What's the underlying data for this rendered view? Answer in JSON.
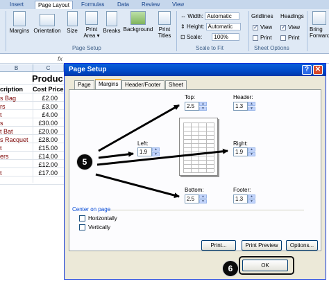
{
  "ribbon": {
    "tabs": [
      {
        "label": "Insert"
      },
      {
        "label": "Page Layout"
      },
      {
        "label": "Formulas"
      },
      {
        "label": "Data"
      },
      {
        "label": "Review"
      },
      {
        "label": "View"
      }
    ],
    "buttons": {
      "margins": "Margins",
      "orientation": "Orientation",
      "size": "Size",
      "print_area_1": "Print",
      "print_area_2": "Area ▾",
      "breaks": "Breaks",
      "background": "Background",
      "print_titles_1": "Print",
      "print_titles_2": "Titles",
      "bring_forward_1": "Bring",
      "bring_forward_2": "Forward"
    },
    "scale": {
      "width_label": "Width:",
      "width_value": "Automatic",
      "height_label": "Height:",
      "height_value": "Automatic",
      "scale_label": "Scale:",
      "scale_value": "100%"
    },
    "sheet_options": {
      "gridlines": "Gridlines",
      "headings": "Headings",
      "view": "View",
      "print": "Print"
    },
    "groups": {
      "page_setup": "Page Setup",
      "scale_to_fit": "Scale to Fit",
      "sheet_options": "Sheet Options"
    }
  },
  "sheet": {
    "formula_icon": "fx",
    "col_b": "B",
    "col_c": "C",
    "title": "Produc",
    "header_b": "cription",
    "header_c": "Cost Price",
    "rows": [
      {
        "b": "s Bag",
        "c": "£2.00"
      },
      {
        "b": "rs",
        "c": "£3.00"
      },
      {
        "b": "t",
        "c": "£4.00"
      },
      {
        "b": "s",
        "c": "£30.00"
      },
      {
        "b": "t Bat",
        "c": "£20.00"
      },
      {
        "b": "s Racquet",
        "c": "£28.00"
      },
      {
        "b": "t",
        "c": "£15.00"
      },
      {
        "b": "ers",
        "c": "£14.00"
      },
      {
        "b": "",
        "c": "£12.00"
      },
      {
        "b": "t",
        "c": "£17.00"
      }
    ]
  },
  "dialog": {
    "title": "Page Setup",
    "help": "?",
    "close": "✕",
    "tabs": [
      {
        "label": "Page"
      },
      {
        "label": "Margins"
      },
      {
        "label": "Header/Footer"
      },
      {
        "label": "Sheet"
      }
    ],
    "margins": {
      "top_label": "Top:",
      "top_value": "2.5",
      "header_label": "Header:",
      "header_value": "1.3",
      "left_label": "Left:",
      "left_value": "1.9",
      "right_label": "Right:",
      "right_value": "1.9",
      "bottom_label": "Bottom:",
      "bottom_value": "2.5",
      "footer_label": "Footer:",
      "footer_value": "1.3"
    },
    "center_on_page": {
      "legend": "Center on page",
      "horizontally": "Horizontally",
      "vertically": "Vertically",
      "horizontally_checked": false,
      "vertically_checked": false
    },
    "buttons": {
      "print": "Print...",
      "print_preview": "Print Preview",
      "options": "Options...",
      "ok": "OK"
    }
  },
  "callouts": {
    "five": "5",
    "six": "6"
  },
  "colors": {
    "ribbon_bg": "#dfe9f5",
    "dialog_bg": "#ece9d8",
    "titlebar": "#0054e3",
    "tab_highlight": "#f5b43c"
  }
}
